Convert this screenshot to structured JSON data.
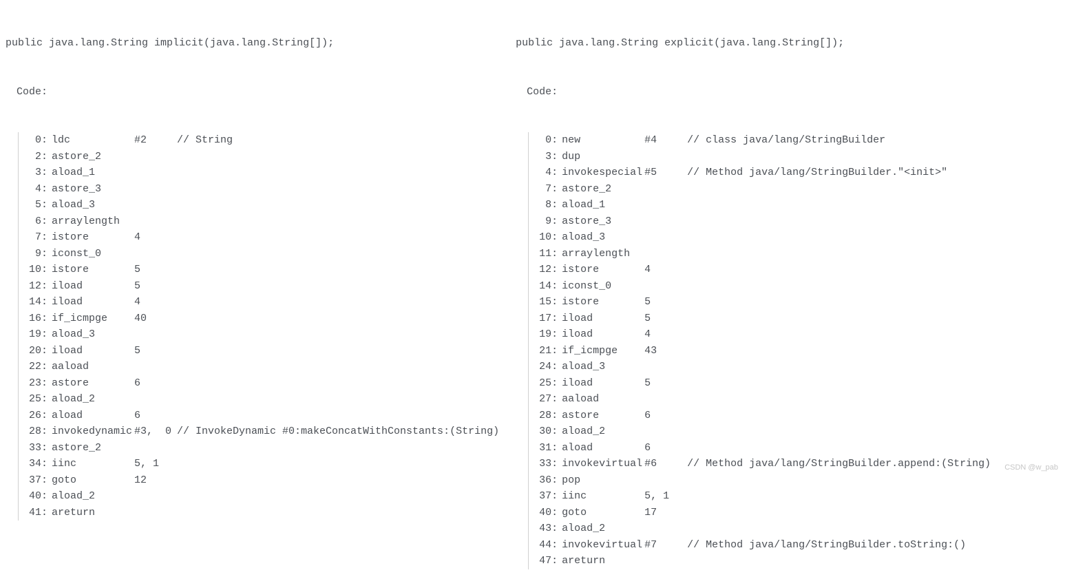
{
  "left": {
    "signature": "public java.lang.String implicit(java.lang.String[]);",
    "codeLabel": "Code:",
    "lines": [
      {
        "offset": "0:",
        "op": "ldc",
        "arg": "#2",
        "comment": "// String"
      },
      {
        "offset": "2:",
        "op": "astore_2",
        "arg": "",
        "comment": ""
      },
      {
        "offset": "3:",
        "op": "aload_1",
        "arg": "",
        "comment": ""
      },
      {
        "offset": "4:",
        "op": "astore_3",
        "arg": "",
        "comment": ""
      },
      {
        "offset": "5:",
        "op": "aload_3",
        "arg": "",
        "comment": ""
      },
      {
        "offset": "6:",
        "op": "arraylength",
        "arg": "",
        "comment": ""
      },
      {
        "offset": "7:",
        "op": "istore",
        "arg": "4",
        "comment": ""
      },
      {
        "offset": "9:",
        "op": "iconst_0",
        "arg": "",
        "comment": ""
      },
      {
        "offset": "10:",
        "op": "istore",
        "arg": "5",
        "comment": ""
      },
      {
        "offset": "12:",
        "op": "iload",
        "arg": "5",
        "comment": ""
      },
      {
        "offset": "14:",
        "op": "iload",
        "arg": "4",
        "comment": ""
      },
      {
        "offset": "16:",
        "op": "if_icmpge",
        "arg": "40",
        "comment": ""
      },
      {
        "offset": "19:",
        "op": "aload_3",
        "arg": "",
        "comment": ""
      },
      {
        "offset": "20:",
        "op": "iload",
        "arg": "5",
        "comment": ""
      },
      {
        "offset": "22:",
        "op": "aaload",
        "arg": "",
        "comment": ""
      },
      {
        "offset": "23:",
        "op": "astore",
        "arg": "6",
        "comment": ""
      },
      {
        "offset": "25:",
        "op": "aload_2",
        "arg": "",
        "comment": ""
      },
      {
        "offset": "26:",
        "op": "aload",
        "arg": "6",
        "comment": ""
      },
      {
        "offset": "28:",
        "op": "invokedynamic",
        "arg": "#3,  0",
        "comment": "// InvokeDynamic #0:makeConcatWithConstants:(String)"
      },
      {
        "offset": "33:",
        "op": "astore_2",
        "arg": "",
        "comment": ""
      },
      {
        "offset": "34:",
        "op": "iinc",
        "arg": "5, 1",
        "comment": ""
      },
      {
        "offset": "37:",
        "op": "goto",
        "arg": "12",
        "comment": ""
      },
      {
        "offset": "40:",
        "op": "aload_2",
        "arg": "",
        "comment": ""
      },
      {
        "offset": "41:",
        "op": "areturn",
        "arg": "",
        "comment": ""
      }
    ]
  },
  "right": {
    "signature": "public java.lang.String explicit(java.lang.String[]);",
    "codeLabel": "Code:",
    "lines": [
      {
        "offset": "0:",
        "op": "new",
        "arg": "#4",
        "comment": "// class java/lang/StringBuilder"
      },
      {
        "offset": "3:",
        "op": "dup",
        "arg": "",
        "comment": ""
      },
      {
        "offset": "4:",
        "op": "invokespecial",
        "arg": "#5",
        "comment": "// Method java/lang/StringBuilder.\"<init>\""
      },
      {
        "offset": "7:",
        "op": "astore_2",
        "arg": "",
        "comment": ""
      },
      {
        "offset": "8:",
        "op": "aload_1",
        "arg": "",
        "comment": ""
      },
      {
        "offset": "9:",
        "op": "astore_3",
        "arg": "",
        "comment": ""
      },
      {
        "offset": "10:",
        "op": "aload_3",
        "arg": "",
        "comment": ""
      },
      {
        "offset": "11:",
        "op": "arraylength",
        "arg": "",
        "comment": ""
      },
      {
        "offset": "12:",
        "op": "istore",
        "arg": "4",
        "comment": ""
      },
      {
        "offset": "14:",
        "op": "iconst_0",
        "arg": "",
        "comment": ""
      },
      {
        "offset": "15:",
        "op": "istore",
        "arg": "5",
        "comment": ""
      },
      {
        "offset": "17:",
        "op": "iload",
        "arg": "5",
        "comment": ""
      },
      {
        "offset": "19:",
        "op": "iload",
        "arg": "4",
        "comment": ""
      },
      {
        "offset": "21:",
        "op": "if_icmpge",
        "arg": "43",
        "comment": ""
      },
      {
        "offset": "24:",
        "op": "aload_3",
        "arg": "",
        "comment": ""
      },
      {
        "offset": "25:",
        "op": "iload",
        "arg": "5",
        "comment": ""
      },
      {
        "offset": "27:",
        "op": "aaload",
        "arg": "",
        "comment": ""
      },
      {
        "offset": "28:",
        "op": "astore",
        "arg": "6",
        "comment": ""
      },
      {
        "offset": "30:",
        "op": "aload_2",
        "arg": "",
        "comment": ""
      },
      {
        "offset": "31:",
        "op": "aload",
        "arg": "6",
        "comment": ""
      },
      {
        "offset": "33:",
        "op": "invokevirtual",
        "arg": "#6",
        "comment": "// Method java/lang/StringBuilder.append:(String)"
      },
      {
        "offset": "36:",
        "op": "pop",
        "arg": "",
        "comment": ""
      },
      {
        "offset": "37:",
        "op": "iinc",
        "arg": "5, 1",
        "comment": ""
      },
      {
        "offset": "40:",
        "op": "goto",
        "arg": "17",
        "comment": ""
      },
      {
        "offset": "43:",
        "op": "aload_2",
        "arg": "",
        "comment": ""
      },
      {
        "offset": "44:",
        "op": "invokevirtual",
        "arg": "#7",
        "comment": "// Method java/lang/StringBuilder.toString:()"
      },
      {
        "offset": "47:",
        "op": "areturn",
        "arg": "",
        "comment": ""
      }
    ]
  },
  "watermark": "CSDN @w_pab"
}
